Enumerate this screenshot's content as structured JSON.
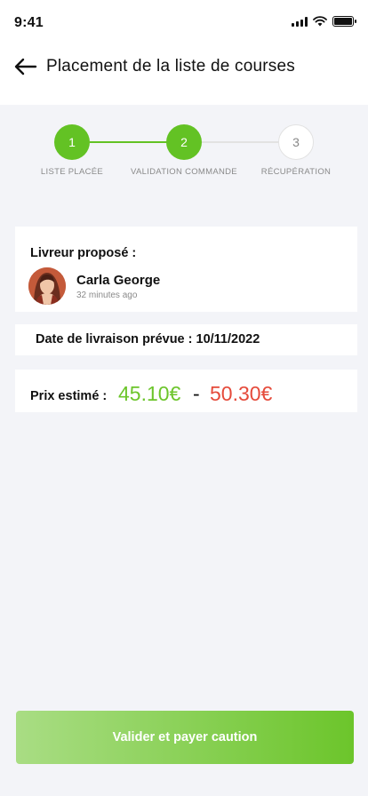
{
  "status_bar": {
    "time": "9:41"
  },
  "header": {
    "title": "Placement de la liste de courses"
  },
  "stepper": {
    "steps": [
      {
        "number": "1",
        "label": "LISTE PLACÉE",
        "state": "done"
      },
      {
        "number": "2",
        "label": "VALIDATION COMMANDE",
        "state": "done"
      },
      {
        "number": "3",
        "label": "RÉCUPÉRATION",
        "state": "todo"
      }
    ],
    "active_color": "#63c224",
    "inactive_color": "#e2e2e2"
  },
  "driver_card": {
    "heading": "Livreur proposé :",
    "name": "Carla George",
    "time_ago": "32 minutes ago"
  },
  "date_card": {
    "text": "Date de livraison prévue : 10/11/2022"
  },
  "price_card": {
    "label": "Prix estimé :",
    "min": "45.10€",
    "separator": "-",
    "max": "50.30€",
    "min_color": "#6cc52b",
    "max_color": "#e54a3a"
  },
  "cta": {
    "label": "Valider et payer caution"
  }
}
